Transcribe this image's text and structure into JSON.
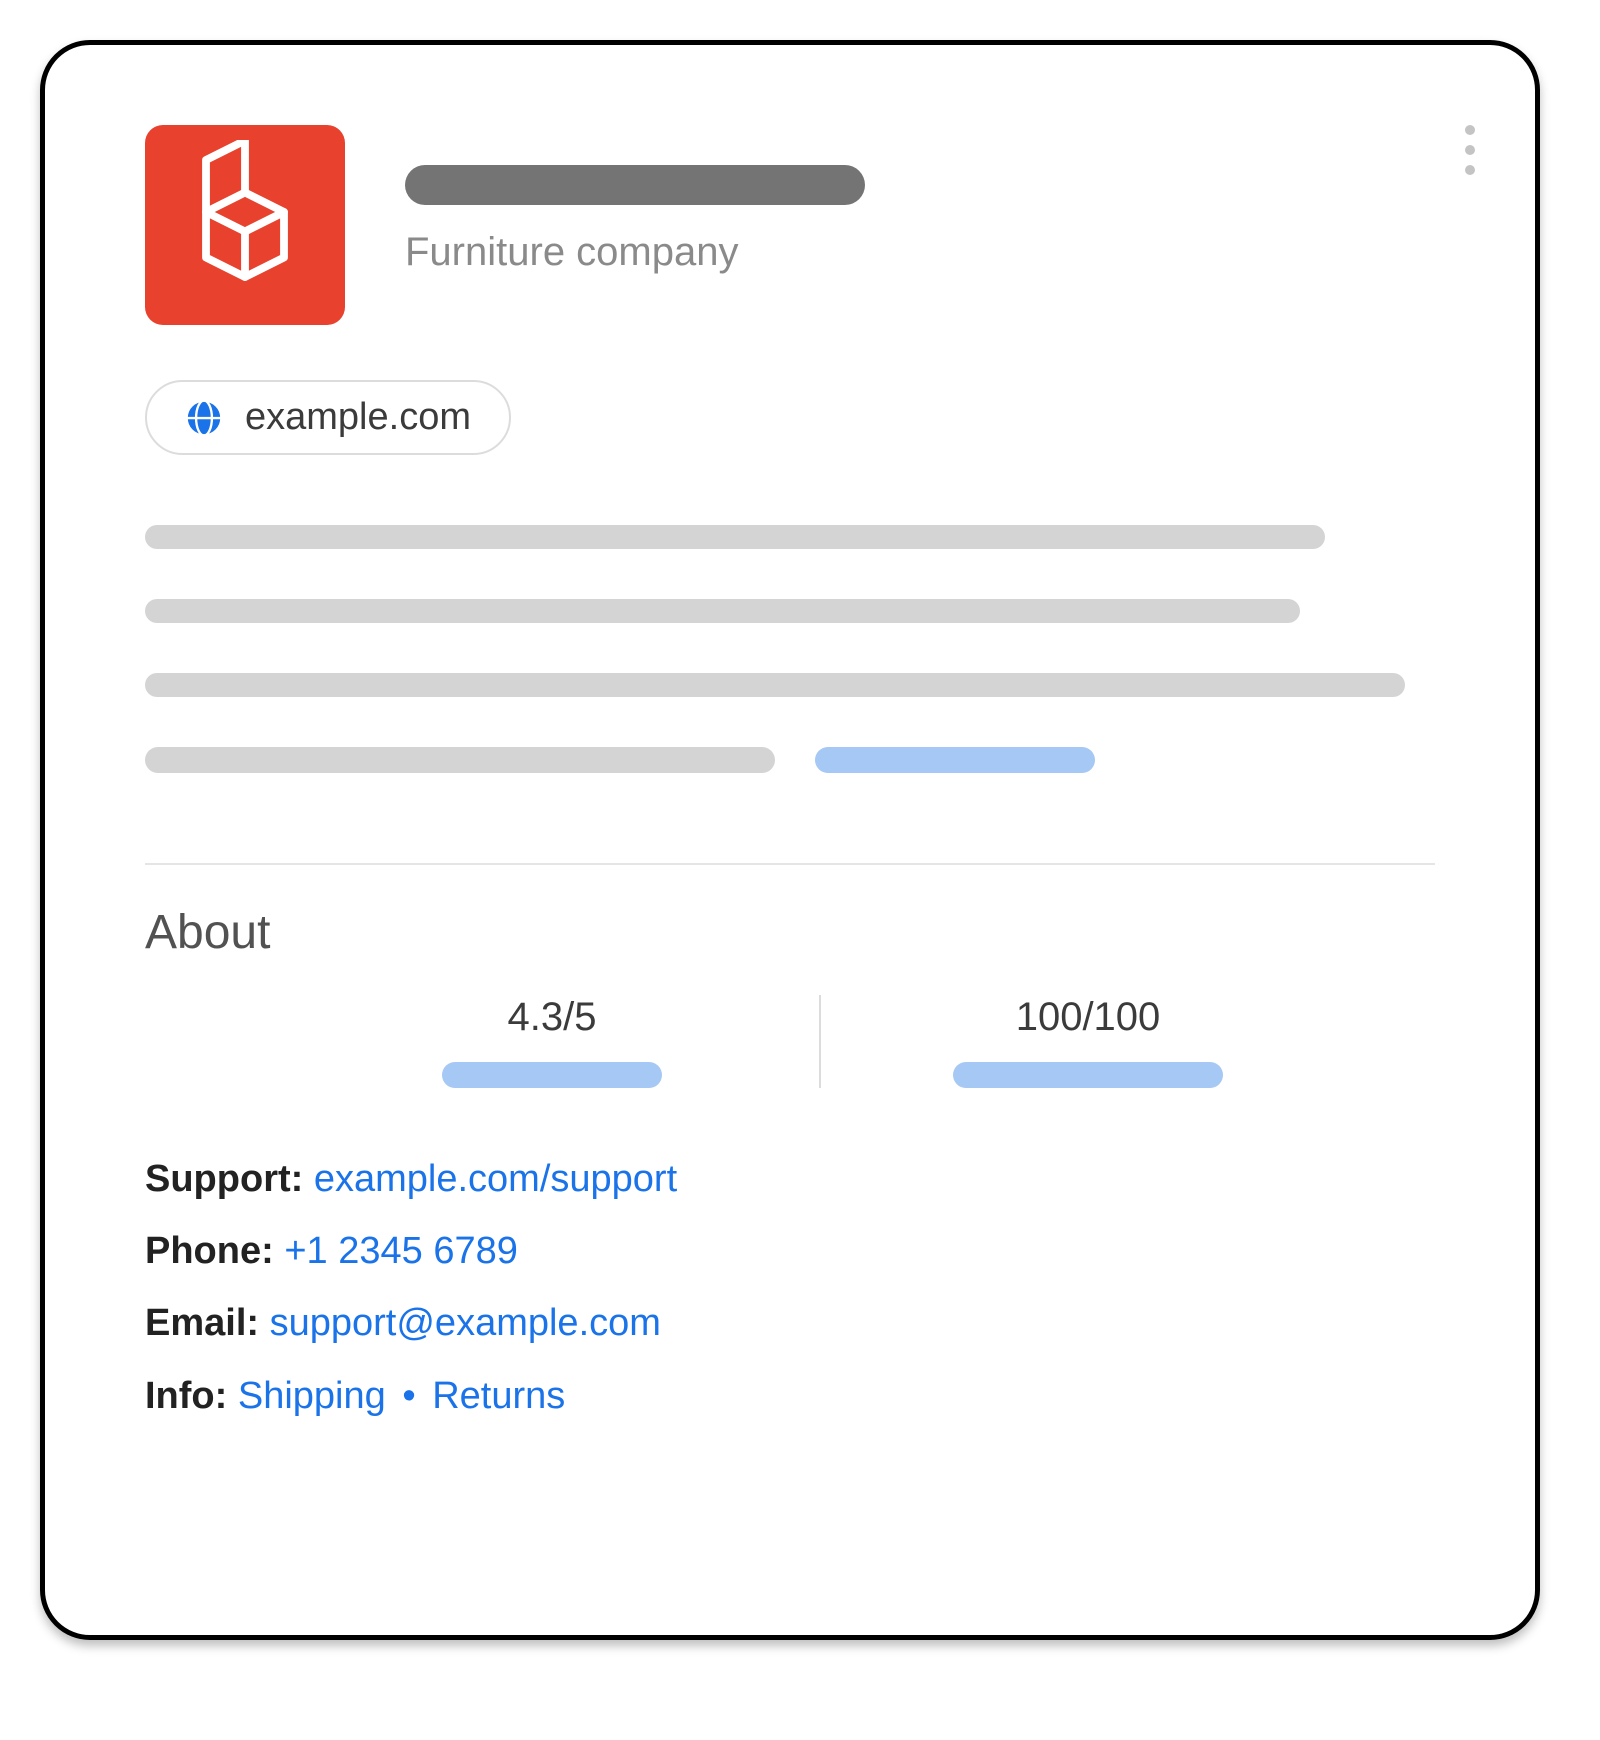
{
  "header": {
    "subtitle": "Furniture company"
  },
  "chip": {
    "domain": "example.com"
  },
  "about": {
    "heading": "About",
    "rating1": "4.3/5",
    "rating2": "100/100"
  },
  "contact": {
    "support_label": "Support:",
    "support_link": "example.com/support",
    "phone_label": "Phone:",
    "phone_link": "+1 2345 6789",
    "email_label": "Email:",
    "email_link": "support@example.com",
    "info_label": "Info:",
    "info_shipping": "Shipping",
    "info_sep": "•",
    "info_returns": "Returns"
  }
}
